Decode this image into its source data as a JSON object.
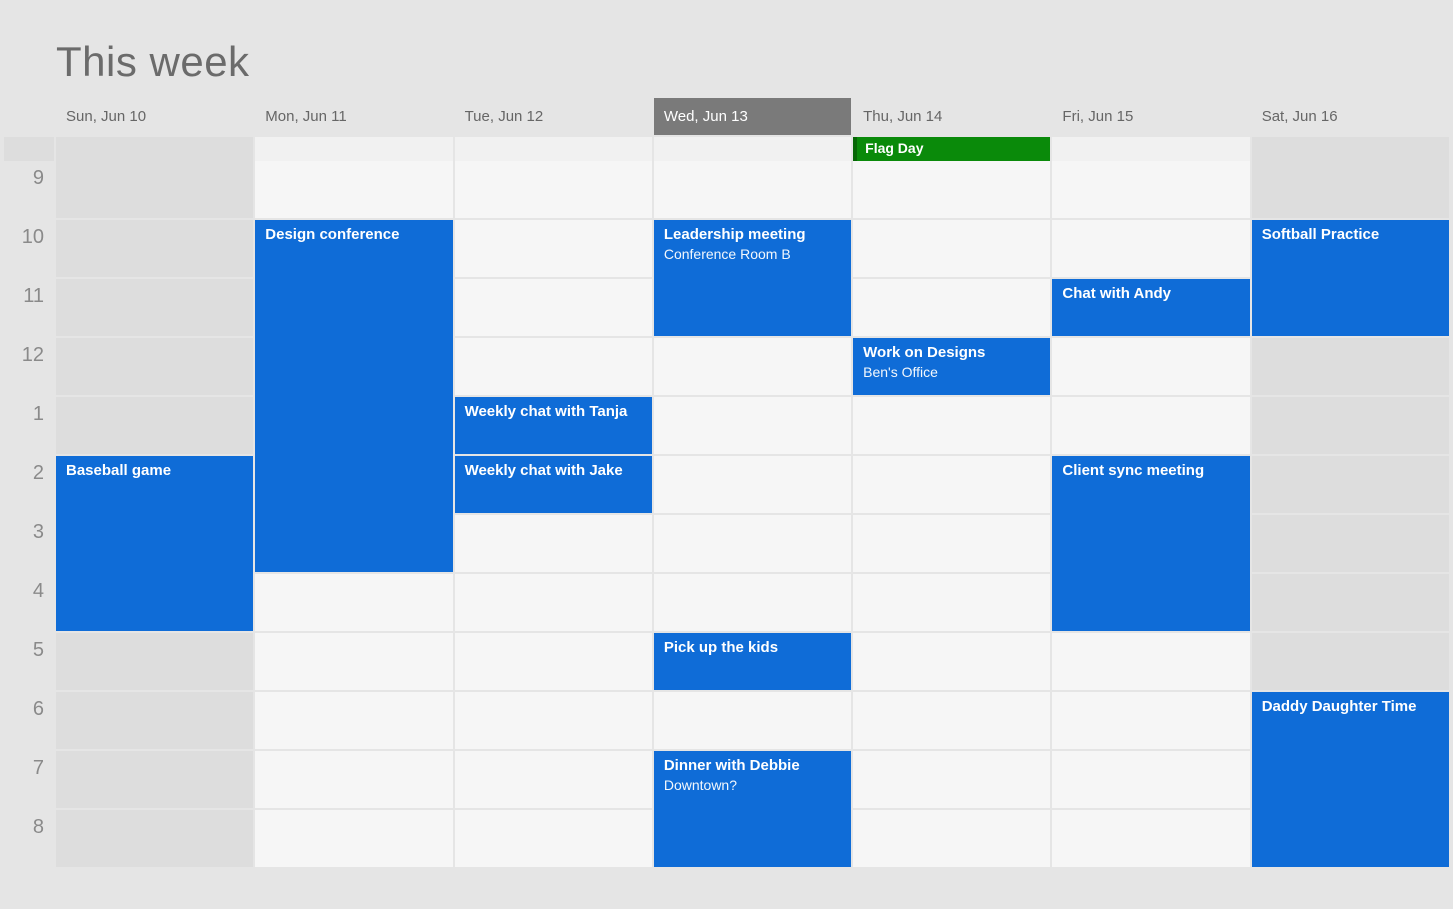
{
  "title": "This week",
  "hours": [
    "9",
    "10",
    "11",
    "12",
    "1",
    "2",
    "3",
    "4",
    "5",
    "6",
    "7",
    "8"
  ],
  "days": [
    {
      "label": "Sun, Jun 10",
      "weekend": true,
      "today": false
    },
    {
      "label": "Mon, Jun 11",
      "weekend": false,
      "today": false
    },
    {
      "label": "Tue, Jun 12",
      "weekend": false,
      "today": false
    },
    {
      "label": "Wed, Jun 13",
      "weekend": false,
      "today": true
    },
    {
      "label": "Thu, Jun 14",
      "weekend": false,
      "today": false
    },
    {
      "label": "Fri, Jun 15",
      "weekend": false,
      "today": false
    },
    {
      "label": "Sat, Jun 16",
      "weekend": true,
      "today": false
    }
  ],
  "allday": [
    {
      "day": 4,
      "title": "Flag Day",
      "color": "#0a8a0a"
    }
  ],
  "events": [
    {
      "day": 0,
      "title": "Baseball game",
      "location": "",
      "startRow": 5,
      "span": 3
    },
    {
      "day": 1,
      "title": "Design conference",
      "location": "",
      "startRow": 1,
      "span": 6
    },
    {
      "day": 2,
      "title": "Weekly chat with Tanja",
      "location": "",
      "startRow": 4,
      "span": 1
    },
    {
      "day": 2,
      "title": "Weekly chat with Jake",
      "location": "",
      "startRow": 5,
      "span": 1
    },
    {
      "day": 3,
      "title": "Leadership meeting",
      "location": "Conference Room B",
      "startRow": 1,
      "span": 2
    },
    {
      "day": 3,
      "title": "Pick up the kids",
      "location": "",
      "startRow": 8,
      "span": 1
    },
    {
      "day": 3,
      "title": "Dinner with Debbie",
      "location": "Downtown?",
      "startRow": 10,
      "span": 2
    },
    {
      "day": 4,
      "title": "Work on Designs",
      "location": "Ben's Office",
      "startRow": 3,
      "span": 1
    },
    {
      "day": 5,
      "title": "Chat with Andy",
      "location": "",
      "startRow": 2,
      "span": 1
    },
    {
      "day": 5,
      "title": "Client sync meeting",
      "location": "",
      "startRow": 5,
      "span": 3
    },
    {
      "day": 6,
      "title": "Softball Practice",
      "location": "",
      "startRow": 1,
      "span": 2
    },
    {
      "day": 6,
      "title": "Daddy Daughter Time",
      "location": "",
      "startRow": 9,
      "span": 3
    }
  ],
  "colors": {
    "event_bg": "#1f6fd6",
    "allday_bg": "#0a8a0a"
  }
}
